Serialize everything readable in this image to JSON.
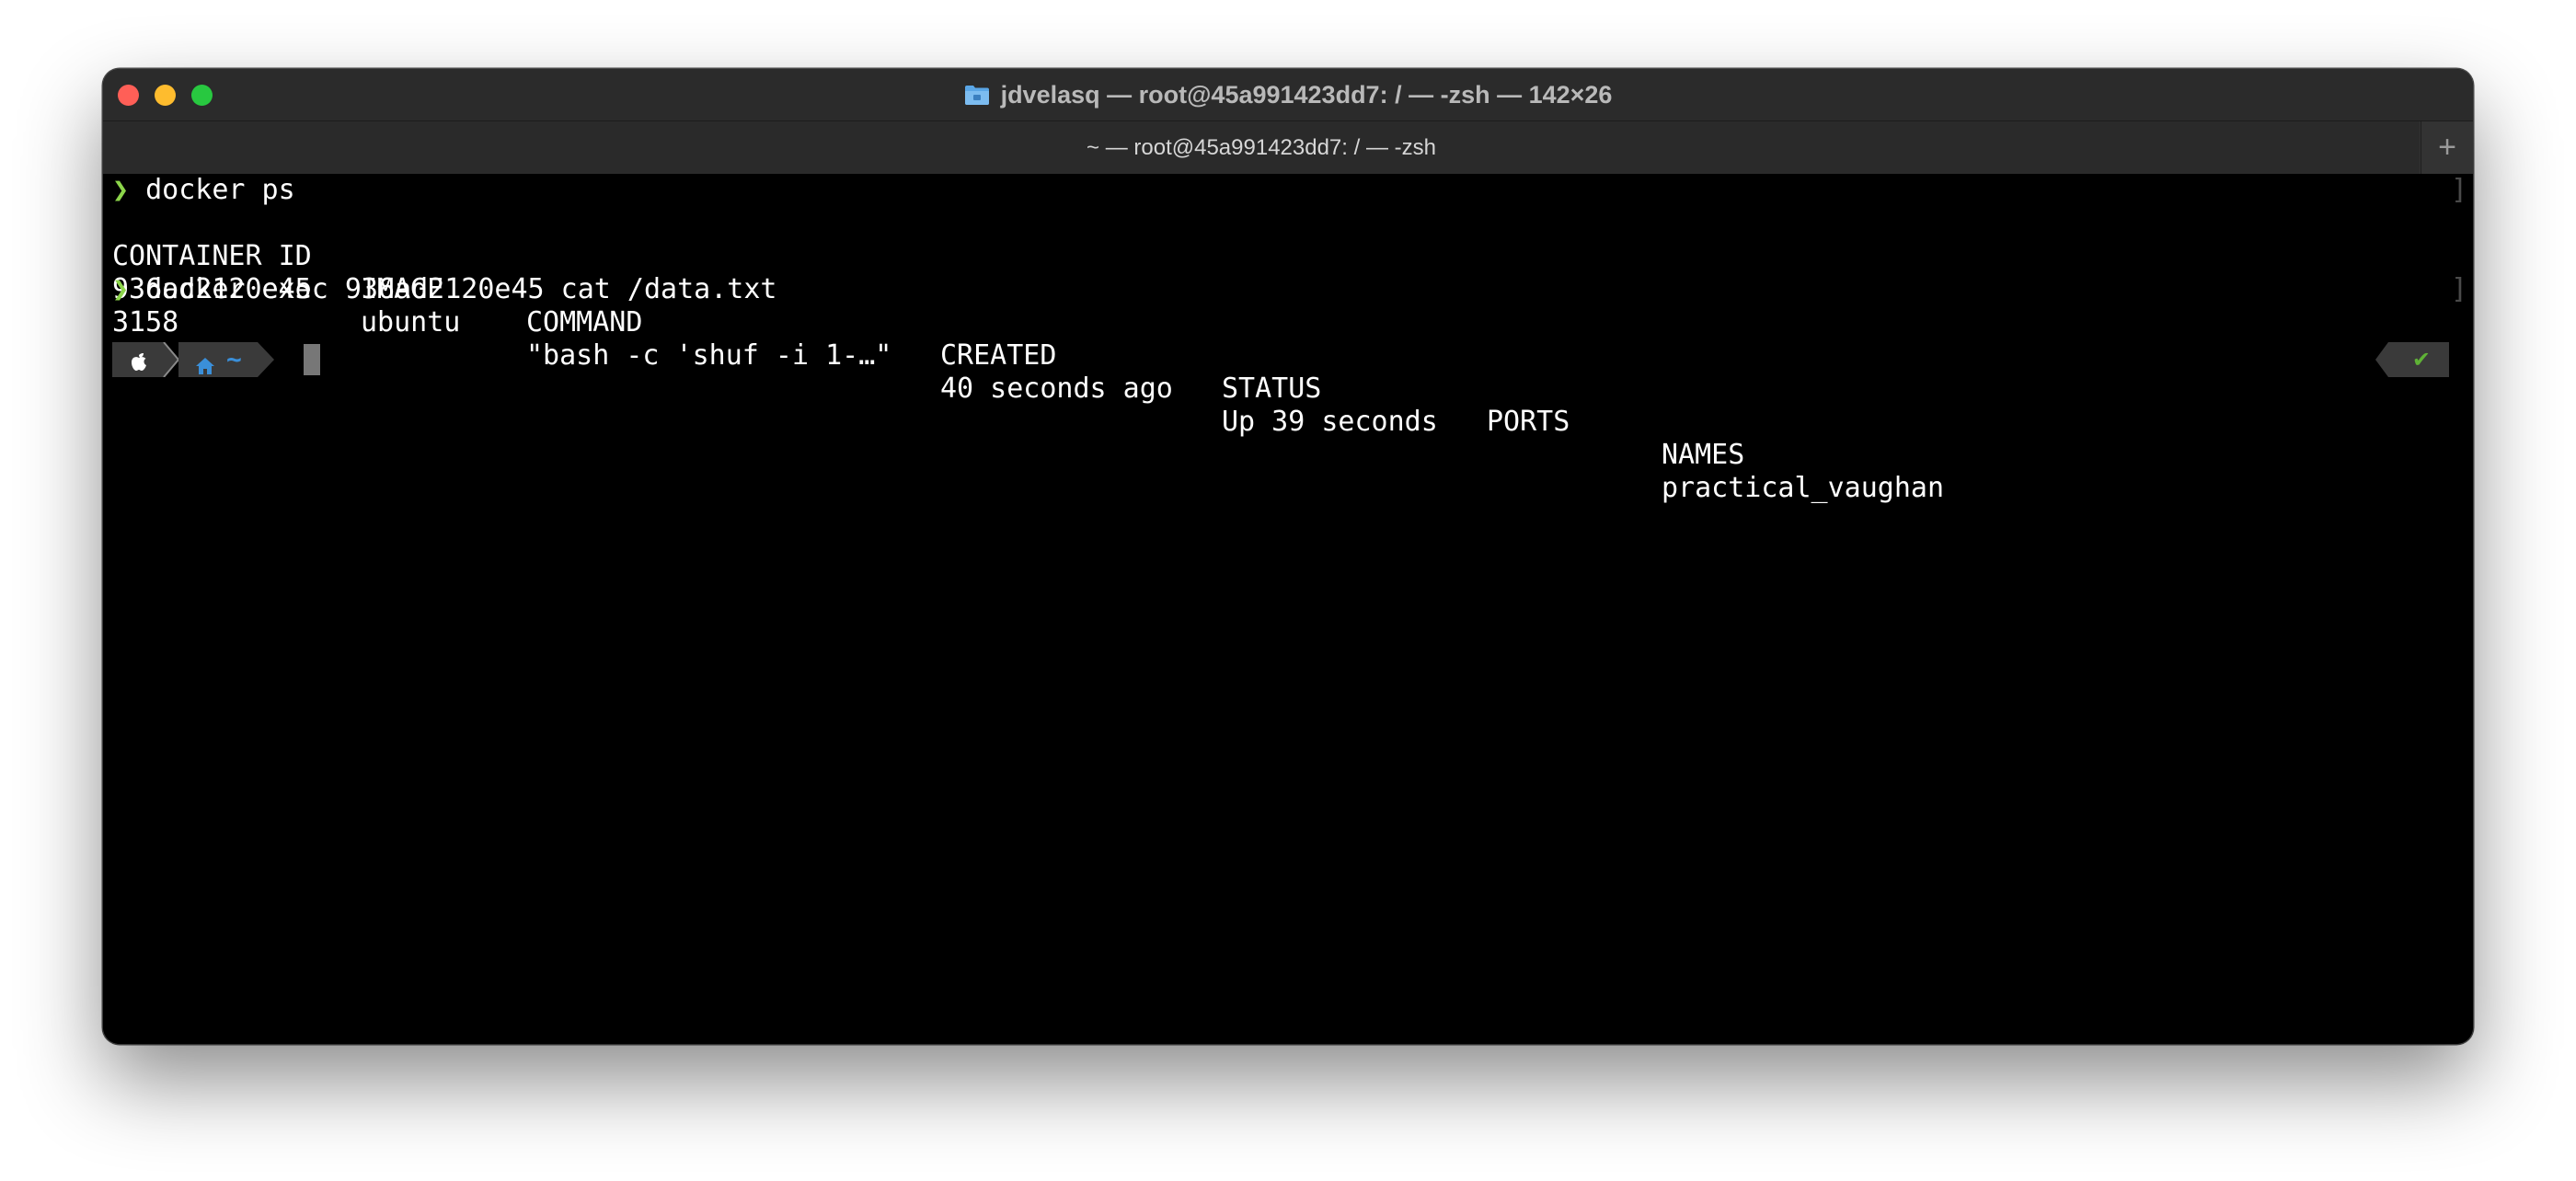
{
  "window": {
    "title": "jdvelasq — root@45a991423dd7: / — -zsh — 142×26",
    "title_icon": "folder-icon"
  },
  "tabs": [
    {
      "label": "~ — root@45a991423dd7: / — -zsh"
    }
  ],
  "new_tab_label": "+",
  "terminal": {
    "prompt_symbol": "❯",
    "commands": [
      "docker ps",
      "docker exec 936ad2120e45 cat /data.txt"
    ],
    "ps_table": {
      "headers": [
        "CONTAINER ID",
        "IMAGE",
        "COMMAND",
        "CREATED",
        "STATUS",
        "PORTS",
        "NAMES"
      ],
      "rows": [
        [
          "936ad2120e45",
          "ubuntu",
          "\"bash -c 'shuf -i 1-…\"",
          "40 seconds ago",
          "Up 39 seconds",
          "",
          "practical_vaughan"
        ]
      ]
    },
    "output": "3158",
    "prompt_segments": {
      "apple_icon": "apple-icon",
      "home_icon": "home-icon",
      "dir": "~"
    },
    "status_icon": "check-icon",
    "status_glyph": "✔"
  },
  "colors": {
    "close": "#ff5f57",
    "minimize": "#febc2e",
    "zoom": "#28c840",
    "prompt_green": "#8cd54a",
    "home_blue": "#3a8fd9",
    "check_green": "#5fb236"
  }
}
